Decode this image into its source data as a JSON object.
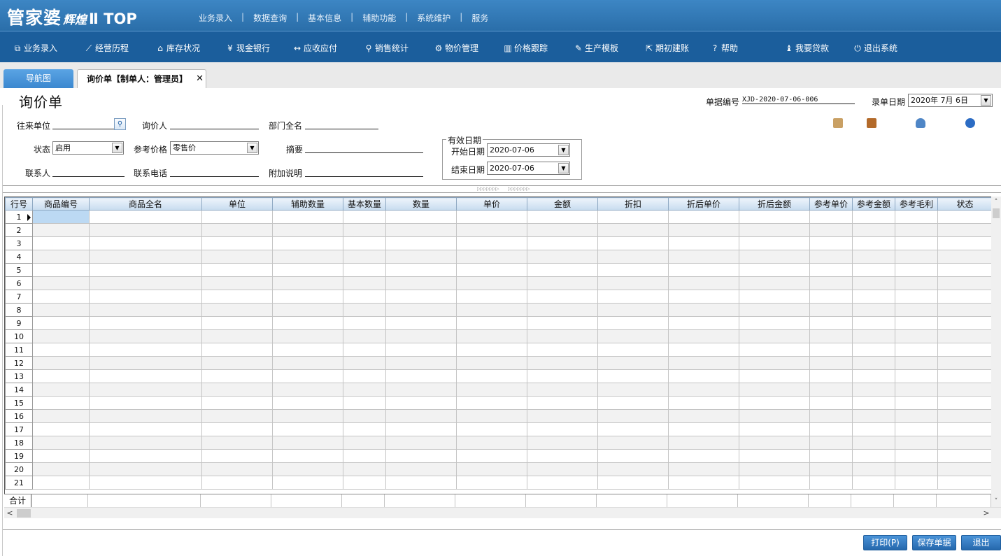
{
  "app": {
    "logo_main": "管家婆",
    "logo_sub": "辉煌",
    "logo_edition": "Ⅱ TOP"
  },
  "top_menu": [
    {
      "label": "业务录入"
    },
    {
      "label": "数据查询"
    },
    {
      "label": "基本信息"
    },
    {
      "label": "辅助功能"
    },
    {
      "label": "系统维护"
    },
    {
      "label": "服务"
    }
  ],
  "top_menu_separator": "|",
  "nav": [
    {
      "label": "业务录入",
      "icon": "order-icon",
      "glyph": "⧉"
    },
    {
      "label": "经营历程",
      "icon": "trend-chart-icon",
      "glyph": "⟋"
    },
    {
      "label": "库存状况",
      "icon": "warehouse-icon",
      "glyph": "⌂"
    },
    {
      "label": "现金银行",
      "icon": "yen-icon",
      "glyph": "¥"
    },
    {
      "label": "应收应付",
      "icon": "exchange-arrows-icon",
      "glyph": "↔"
    },
    {
      "label": "销售统计",
      "icon": "search-icon",
      "glyph": "⚲"
    },
    {
      "label": "物价管理",
      "icon": "gear-icon",
      "glyph": "⚙"
    },
    {
      "label": "价格跟踪",
      "icon": "bar-chart-icon",
      "glyph": "▥"
    },
    {
      "label": "生产模板",
      "icon": "wrench-icon",
      "glyph": "✎"
    },
    {
      "label": "期初建账",
      "icon": "export-icon",
      "glyph": "⇱"
    },
    {
      "label": "帮助",
      "icon": "help-icon",
      "glyph": "?"
    },
    {
      "label": "我要贷款",
      "icon": "money-bag-icon",
      "glyph": "♝"
    },
    {
      "label": "退出系统",
      "icon": "power-icon",
      "glyph": "⏻"
    }
  ],
  "tabs": {
    "nav_tab": "导航图",
    "active_tab": "询价单【制单人：管理员】",
    "close_glyph": "✕"
  },
  "form": {
    "title": "询价单",
    "doc_no_label": "单据编号",
    "doc_no_value": "XJD-2020-07-06-006",
    "entry_date_label": "录单日期",
    "entry_date_value": "2020年 7月 6日",
    "partner_label": "往来单位",
    "inquirer_label": "询价人",
    "department_label": "部门全名",
    "status_label": "状态",
    "status_value": "启用",
    "ref_price_label": "参考价格",
    "ref_price_value": "零售价",
    "summary_label": "摘要",
    "contact_label": "联系人",
    "phone_label": "联系电话",
    "note_label": "附加说明",
    "valid_group_label": "有效日期",
    "start_date_label": "开始日期",
    "start_date_value": "2020-07-06",
    "end_date_label": "结束日期",
    "end_date_value": "2020-07-06"
  },
  "toolbar_icons": [
    {
      "icon": "package-icon",
      "color": "#c9a064"
    },
    {
      "icon": "door-icon",
      "color": "#b36a2a"
    },
    {
      "icon": "person-icon",
      "color": "#4f86c6"
    },
    {
      "icon": "help-circle-icon",
      "color": "#2c6cc4"
    }
  ],
  "grid": {
    "columns": [
      "行号",
      "商品编号",
      "商品全名",
      "单位",
      "辅助数量",
      "基本数量",
      "数量",
      "单价",
      "金额",
      "折扣",
      "折后单价",
      "折后金额",
      "参考单价",
      "参考金额",
      "参考毛利",
      "状态"
    ],
    "rows": [
      "1",
      "2",
      "3",
      "4",
      "5",
      "6",
      "7",
      "8",
      "9",
      "10",
      "11",
      "12",
      "13",
      "14",
      "15",
      "16",
      "17",
      "18",
      "19",
      "20",
      "21"
    ],
    "total_label": "合计"
  },
  "scroll": {
    "up": "˄",
    "down": "˅",
    "left": "<",
    "right": ">"
  },
  "buttons": {
    "print": "打印(P)",
    "save": "保存单据",
    "exit": "退出"
  },
  "colors": {
    "topbar": "#2f76b3",
    "navbar": "#1b5e9c",
    "button": "#3177bd",
    "selected_cell": "#bcd9f3"
  }
}
